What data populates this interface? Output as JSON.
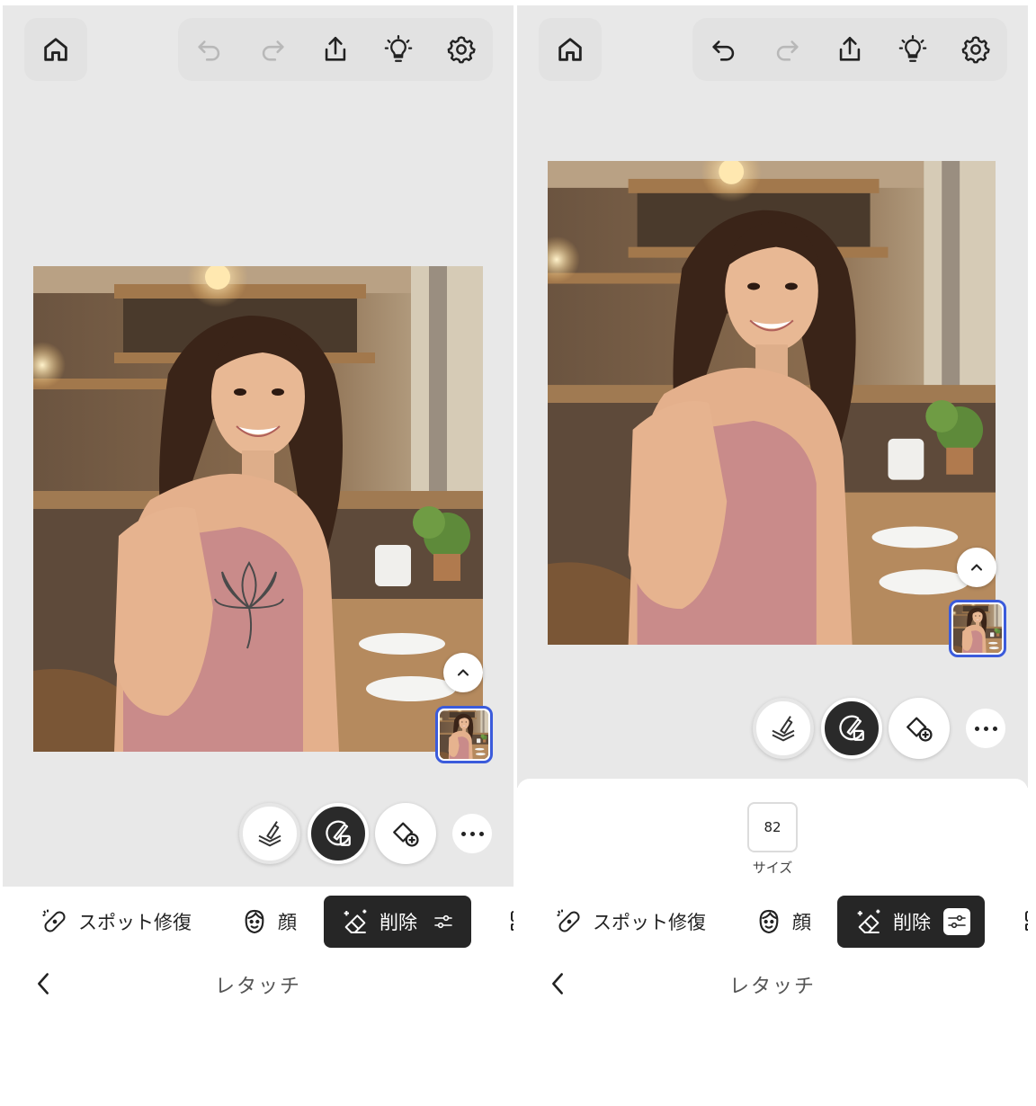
{
  "left_screen": {
    "tabs": {
      "spot_heal": "スポット修復",
      "face": "顔",
      "remove": "削除"
    },
    "footer": {
      "title": "レタッチ"
    },
    "toolbar": {
      "undo_enabled": false,
      "redo_enabled": false
    }
  },
  "right_screen": {
    "size_panel": {
      "value": "82",
      "label": "サイズ"
    },
    "tabs": {
      "spot_heal": "スポット修復",
      "face": "顔",
      "remove": "削除"
    },
    "footer": {
      "title": "レタッチ"
    },
    "toolbar": {
      "undo_enabled": true,
      "redo_enabled": false
    }
  },
  "icons": [
    "home-icon",
    "undo-icon",
    "redo-icon",
    "share-icon",
    "lightbulb-icon",
    "gear-icon",
    "chevron-up-icon",
    "layers-brush-icon",
    "brush-eraser-icon",
    "shape-add-icon",
    "more-icon",
    "bandage-icon",
    "face-icon",
    "eraser-sparkle-icon",
    "sliders-icon",
    "chevron-left-icon"
  ],
  "colors": {
    "active_tab": "#262626",
    "canvas_bg": "#e8e8e8",
    "thumb_border": "#3b5bdb",
    "disabled_icon": "#b8b8b8"
  }
}
